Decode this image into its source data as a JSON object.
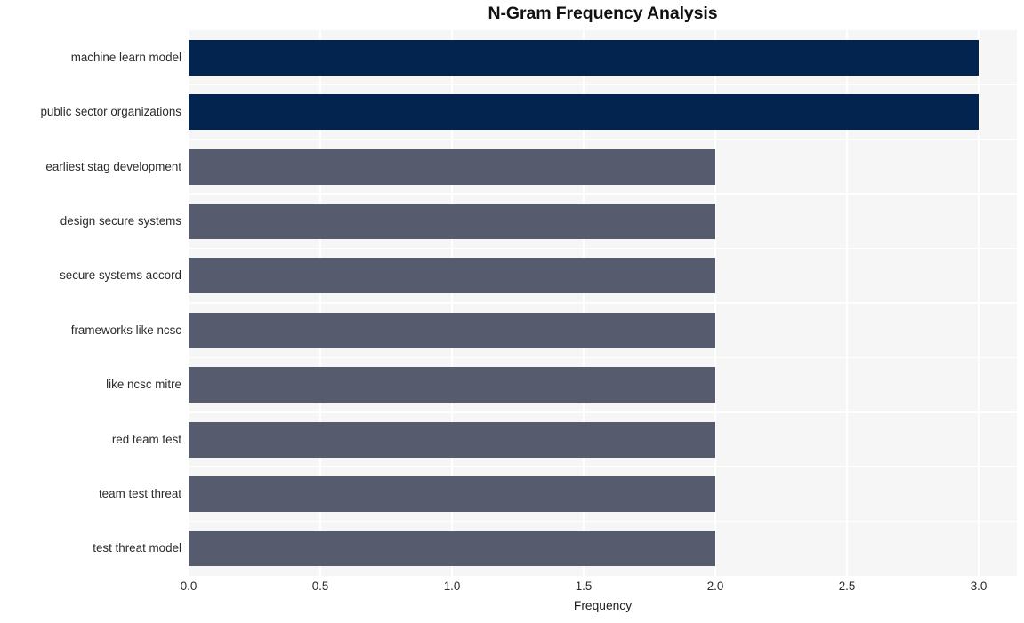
{
  "chart_data": {
    "type": "bar",
    "orientation": "horizontal",
    "title": "N-Gram Frequency Analysis",
    "xlabel": "Frequency",
    "ylabel": "",
    "xlim": [
      0.0,
      3.0
    ],
    "xticks": [
      "0.0",
      "0.5",
      "1.0",
      "1.5",
      "2.0",
      "2.5",
      "3.0"
    ],
    "xtick_values": [
      0.0,
      0.5,
      1.0,
      1.5,
      2.0,
      2.5,
      3.0
    ],
    "grid": true,
    "legend": "none",
    "categories": [
      "machine learn model",
      "public sector organizations",
      "earliest stag development",
      "design secure systems",
      "secure systems accord",
      "frameworks like ncsc",
      "like ncsc mitre",
      "red team test",
      "team test threat",
      "test threat model"
    ],
    "values": [
      3,
      3,
      2,
      2,
      2,
      2,
      2,
      2,
      2,
      2
    ],
    "bar_colors": [
      "#042450",
      "#042450",
      "#565c6e",
      "#565c6e",
      "#565c6e",
      "#565c6e",
      "#565c6e",
      "#565c6e",
      "#565c6e",
      "#565c6e"
    ]
  },
  "style": {
    "figure_background": "#ffffff",
    "plot_background": "#f6f6f7",
    "gridline_color": "#ffffff",
    "highlight_color": "#042450",
    "base_color": "#565c6e",
    "text_color": "#2b2b2b"
  }
}
